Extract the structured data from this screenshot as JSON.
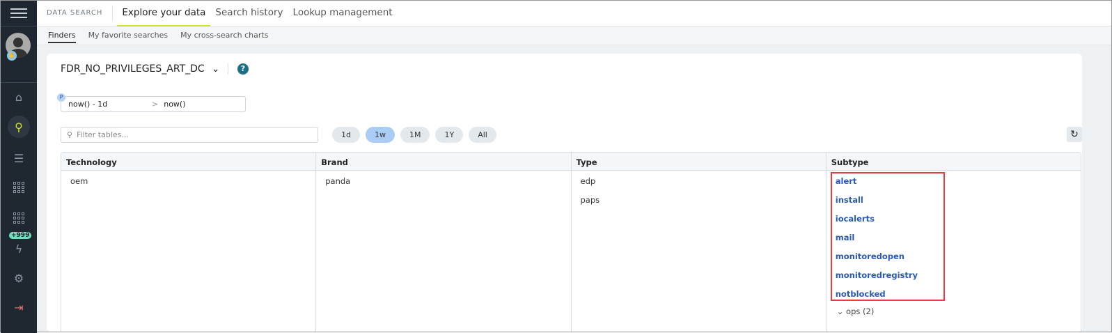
{
  "sidebar": {
    "badge": "+999",
    "items": [
      "home-icon",
      "search-icon",
      "sliders-icon",
      "apps-icon",
      "apps-icon",
      "bolt-icon",
      "gear-icon",
      "logout-icon"
    ]
  },
  "header": {
    "brand": "DATA SEARCH",
    "tabs": [
      {
        "label": "Explore your data",
        "active": true
      },
      {
        "label": "Search history"
      },
      {
        "label": "Lookup management"
      }
    ]
  },
  "subtabs": [
    {
      "label": "Finders",
      "active": true
    },
    {
      "label": "My favorite searches"
    },
    {
      "label": "My cross-search charts"
    }
  ],
  "finder": {
    "name": "FDR_NO_PRIVILEGES_ART_DC",
    "help": "?"
  },
  "daterange": {
    "badge": "P",
    "from": "now() - 1d",
    "sep": ">",
    "to": "now()"
  },
  "filter": {
    "placeholder": "Filter tables..."
  },
  "ranges": [
    {
      "label": "1d"
    },
    {
      "label": "1w",
      "active": true
    },
    {
      "label": "1M"
    },
    {
      "label": "1Y"
    },
    {
      "label": "All"
    }
  ],
  "table": {
    "headers": [
      "Technology",
      "Brand",
      "Type",
      "Subtype"
    ],
    "technology": [
      "oem"
    ],
    "brand": [
      "panda"
    ],
    "type": [
      "edp",
      "paps"
    ],
    "subtype": [
      "alert",
      "install",
      "iocalerts",
      "mail",
      "monitoredopen",
      "monitoredregistry",
      "notblocked"
    ],
    "collapsed": "ops (2)"
  },
  "colors": {
    "accent": "#cde01e",
    "link": "#2a58b5",
    "highlight": "#f0393b"
  }
}
